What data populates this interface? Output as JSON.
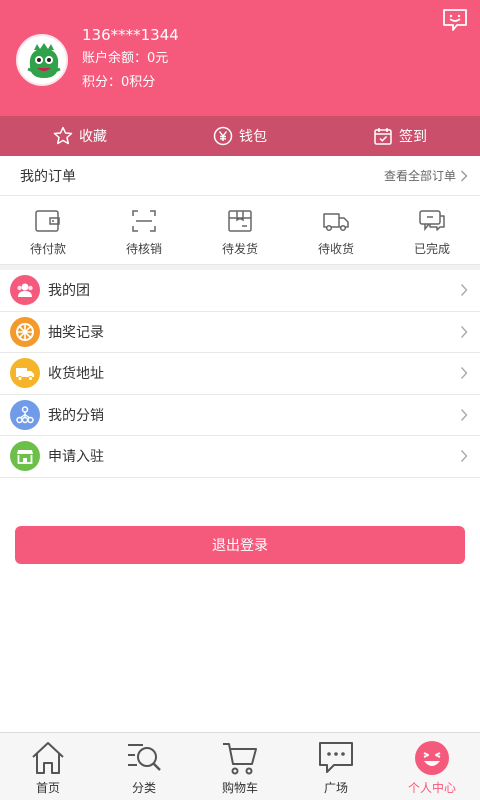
{
  "header": {
    "phone": "136****1344",
    "balance": "账户余额：0元",
    "points": "积分：0积分"
  },
  "quickbar": {
    "favorite": "收藏",
    "wallet": "钱包",
    "signin": "签到"
  },
  "orders": {
    "title": "我的订单",
    "view_all": "查看全部订单",
    "items": [
      {
        "label": "待付款"
      },
      {
        "label": "待核销"
      },
      {
        "label": "待发货"
      },
      {
        "label": "待收货"
      },
      {
        "label": "已完成"
      }
    ]
  },
  "menu": [
    {
      "label": "我的团",
      "color": "#f55a7d"
    },
    {
      "label": "抽奖记录",
      "color": "#f39a2b"
    },
    {
      "label": "收货地址",
      "color": "#f6b42a"
    },
    {
      "label": "我的分销",
      "color": "#6f9be8"
    },
    {
      "label": "申请入驻",
      "color": "#6cc04a"
    }
  ],
  "logout_label": "退出登录",
  "tabbar": {
    "items": [
      {
        "label": "首页"
      },
      {
        "label": "分类"
      },
      {
        "label": "购物车"
      },
      {
        "label": "广场"
      },
      {
        "label": "个人中心"
      }
    ]
  },
  "colors": {
    "brand": "#f55a7d",
    "quickbar": "#c94f6a"
  }
}
